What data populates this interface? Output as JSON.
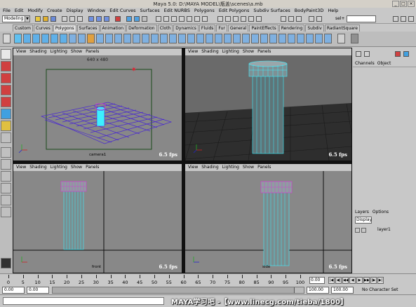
{
  "window": {
    "title": "Maya 5.0: D:\\MAYA MODEL\\瓶盖\\scenes\\a.mb"
  },
  "menubar": [
    "File",
    "Edit",
    "Modify",
    "Create",
    "Display",
    "Window",
    "Edit Curves",
    "Surfaces",
    "Edit NURBS",
    "Polygons",
    "Edit Polygons",
    "Subdiv Surfaces",
    "BodyPaint3D",
    "Help"
  ],
  "statusline": {
    "mode": "Modeling",
    "sel_label": "sel+"
  },
  "shelf": {
    "tabs": [
      "Custom",
      "Curves",
      "Polygons",
      "Surfaces",
      "Animation",
      "Deformation",
      "Cloth",
      "Dynamics",
      "Fluids",
      "Fur",
      "General",
      "PaintEffects",
      "Rendering",
      "Subdiv",
      "RadiantSquare"
    ],
    "active_tab": "Polygons"
  },
  "panel_menu": [
    "View",
    "Shading",
    "Lighting",
    "Show",
    "Panels"
  ],
  "viewports": {
    "top_left": {
      "resolution_gate": "640 x 480",
      "fps": "6.5 fps",
      "camera": "camera1"
    },
    "top_right": {
      "fps": "6.5 fps"
    },
    "bottom_left": {
      "fps": "6.5 fps",
      "camera": "front"
    },
    "bottom_right": {
      "fps": "6.5 fps",
      "camera": "side"
    }
  },
  "right_panel": {
    "channel_menu": [
      "Channels",
      "Object"
    ],
    "layers_menu": [
      "Layers",
      "Options"
    ],
    "layer_display": "Display",
    "layer_name": "layer1"
  },
  "timeline": {
    "ticks": [
      "0",
      "5",
      "10",
      "15",
      "20",
      "25",
      "30",
      "35",
      "40",
      "45",
      "50",
      "55",
      "60",
      "65",
      "70",
      "75",
      "80",
      "85",
      "90",
      "95",
      "100"
    ],
    "current_frame": "0.00"
  },
  "range": {
    "start": "0.00",
    "inner_start": "0.00",
    "end": "100.00",
    "end_outer": "100.00",
    "character": "No Character Set"
  },
  "watermark": "MAYA学习吧 -【www.linecg.com/tieba/1800】",
  "colors": {
    "wire": "#5a28c8",
    "cyan": "#3cf0ff",
    "grid": "#4a2ad0",
    "viewport_bg": "#888888"
  }
}
